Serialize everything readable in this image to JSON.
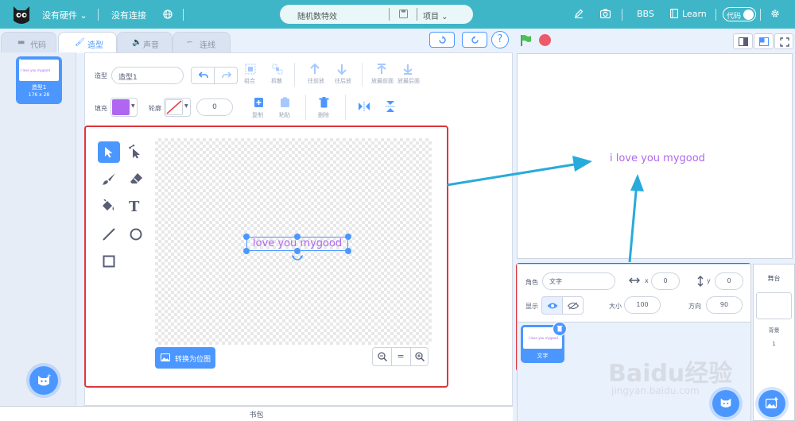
{
  "topbar": {
    "hardware": "没有硬件",
    "connection": "没有连接",
    "project_name": "随机数特效",
    "project_menu": "项目",
    "bbs": "BBS",
    "learn": "Learn",
    "code_toggle": "代码"
  },
  "tabs": {
    "code": "代码",
    "costume": "造型",
    "sound": "声音",
    "connect": "连线"
  },
  "costume_list": {
    "index": "1",
    "name": "造型1",
    "size": "176 x 28",
    "thumb_text": "I love you mygood"
  },
  "editor": {
    "costume_label": "造型",
    "costume_name": "造型1",
    "fill_label": "填充",
    "outline_label": "轮廓",
    "outline_width": "0",
    "fill_color": "#b066f0",
    "tools_row1": [
      "组合",
      "拆散",
      "往前放",
      "往后放",
      "放最前面",
      "放最后面"
    ],
    "copy_label": "复制",
    "paste_label": "粘贴",
    "delete_label": "删除",
    "canvas_text": "love you mygood",
    "convert_button": "转换为位图",
    "zoom_reset": "="
  },
  "stage": {
    "text": "i love you mygood",
    "text_color": "#b066f0"
  },
  "sprite_panel": {
    "sprite_label": "角色",
    "sprite_name": "文字",
    "x_label": "x",
    "x_value": "0",
    "y_label": "y",
    "y_value": "0",
    "show_label": "显示",
    "size_label": "大小",
    "size_value": "100",
    "direction_label": "方向",
    "direction_value": "90",
    "sprite_item_name": "文字"
  },
  "stage_panel": {
    "title": "舞台",
    "backdrop_label": "背景",
    "backdrop_count": "1"
  },
  "backpack": {
    "label": "书包"
  },
  "watermark": {
    "line1": "Baidu经验",
    "line2": "jingyan.baidu.com"
  }
}
